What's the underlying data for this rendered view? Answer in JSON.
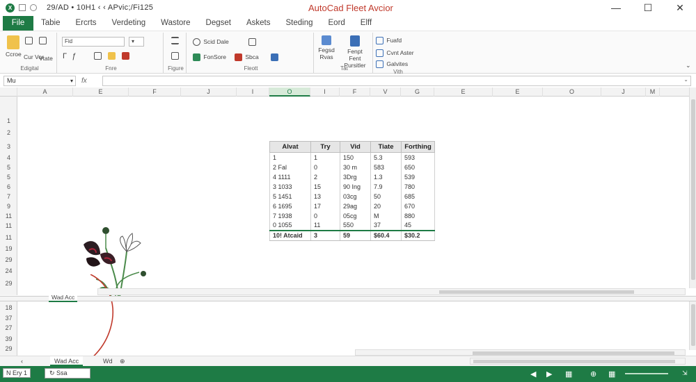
{
  "title_bar": {
    "quick_access_text": "29/AD • 10H1 ‹ ‹ APvic;/Fi125",
    "app_title": "AutoCad Fleet Avcior",
    "minimize": "—",
    "restore": "☐",
    "close": "✕"
  },
  "tabs": [
    "File",
    "Tabie",
    "Ercrts",
    "Verdeting",
    "Wastore",
    "Degset",
    "Askets",
    "Steding",
    "Eord",
    "Elff"
  ],
  "ribbon": {
    "clipboard": {
      "label": "Edigital",
      "paste": "Ccroe",
      "cut": "Cur Vor",
      "copy": "Vtate"
    },
    "font": {
      "label": "Fnre",
      "font_name": "Fid",
      "bold": "Γ",
      "italic": "ƒ"
    },
    "alignment": {
      "label": "Figure"
    },
    "number": {
      "label": "Fleott",
      "sort": "Scid Dale",
      "format": "FonSore",
      "style": "Sbca"
    },
    "cells": {
      "insert": "Fegsd Rvas",
      "format_sheet": "Fenpt Fent Pursitler",
      "label": "Tat"
    },
    "editing": {
      "fill": "Fuafd",
      "clear": "Cvnt Aster",
      "sort": "Galvites",
      "label": "Vith"
    }
  },
  "formula_bar": {
    "name_box": "Mu",
    "fx": "fx",
    "value": ""
  },
  "columns": [
    {
      "label": "A",
      "selected": false
    },
    {
      "label": "E",
      "selected": false
    },
    {
      "label": "F",
      "selected": false
    },
    {
      "label": "J",
      "selected": false
    },
    {
      "label": "I",
      "selected": false
    },
    {
      "label": "O",
      "selected": true
    },
    {
      "label": "I",
      "selected": false
    },
    {
      "label": "F",
      "selected": false
    },
    {
      "label": "V",
      "selected": false
    },
    {
      "label": "G",
      "selected": false
    },
    {
      "label": "E",
      "selected": false
    },
    {
      "label": "E",
      "selected": false
    },
    {
      "label": "O",
      "selected": false
    },
    {
      "label": "J",
      "selected": false
    },
    {
      "label": "M",
      "selected": false
    }
  ],
  "rows_top": [
    "1",
    "2",
    "3",
    "4",
    "5",
    "5",
    "6",
    "7",
    "9",
    "11",
    "11",
    "11",
    "19",
    "29",
    "24",
    "29"
  ],
  "rows_bottom": [
    "18",
    "37",
    "27",
    "39",
    "29"
  ],
  "table": {
    "headers": [
      "Alvat",
      "Try",
      "Vid",
      "Tiate",
      "Forthing"
    ],
    "rows": [
      [
        "1",
        "1",
        "150",
        "5.3",
        "593"
      ],
      [
        "2  Fal",
        "0",
        "30 m",
        "583",
        "650"
      ],
      [
        "4  1111",
        "2",
        "3Drg",
        "1.3",
        "539"
      ],
      [
        "3  1033",
        "15",
        "90 Ing",
        "7.9",
        "780"
      ],
      [
        "5  1451",
        "13",
        "03cg",
        "50",
        "685"
      ],
      [
        "6  1695",
        "17",
        "29ag",
        "20",
        "670"
      ],
      [
        "7  1938",
        "0",
        "05cg",
        "M",
        "880"
      ],
      [
        "0  1055",
        "11",
        "550",
        "37",
        "45"
      ]
    ],
    "total": [
      "10! Atcaid",
      "3",
      "59",
      "$60.4",
      "$30.2"
    ]
  },
  "sheet_tabs": {
    "active": "Wad Acc",
    "other": "Wd"
  },
  "status_bar": {
    "left": "N Ery 1",
    "sheet": "↻ Ssa",
    "zoom": "⊕"
  }
}
